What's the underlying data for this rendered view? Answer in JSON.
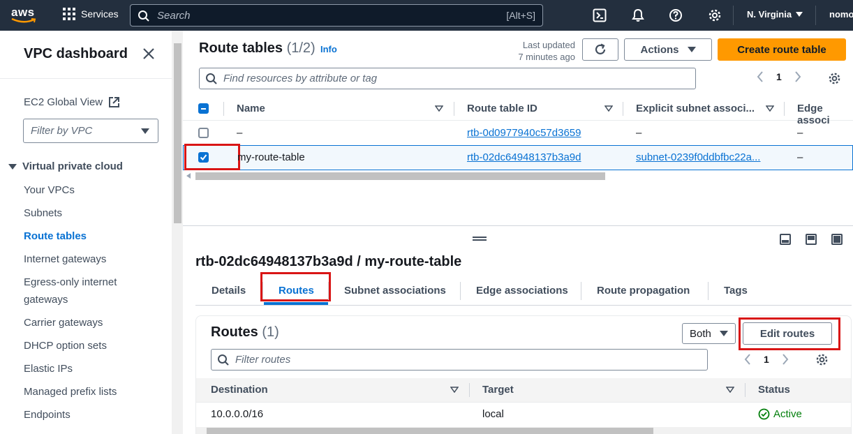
{
  "topnav": {
    "logo": "aws",
    "services": "Services",
    "search_placeholder": "Search",
    "search_shortcut": "[Alt+S]",
    "region": "N. Virginia",
    "account": "nomo"
  },
  "sidebar": {
    "title": "VPC dashboard",
    "ec2_global_view": "EC2 Global View",
    "filter_placeholder": "Filter by VPC",
    "section": "Virtual private cloud",
    "items": [
      {
        "label": "Your VPCs"
      },
      {
        "label": "Subnets"
      },
      {
        "label": "Route tables",
        "active": true
      },
      {
        "label": "Internet gateways"
      },
      {
        "label": "Egress-only internet"
      },
      {
        "label": "gateways"
      },
      {
        "label": "Carrier gateways"
      },
      {
        "label": "DHCP option sets"
      },
      {
        "label": "Elastic IPs"
      },
      {
        "label": "Managed prefix lists"
      },
      {
        "label": "Endpoints"
      }
    ]
  },
  "route_tables": {
    "title": "Route tables",
    "count": "(1/2)",
    "info": "Info",
    "last_updated_line1": "Last updated",
    "last_updated_line2": "7 minutes ago",
    "actions_label": "Actions",
    "create_label": "Create route table",
    "filter_placeholder": "Find resources by attribute or tag",
    "page": "1",
    "columns": [
      "Name",
      "Route table ID",
      "Explicit subnet associ...",
      "Edge associ"
    ],
    "rows": [
      {
        "name": "–",
        "id": "rtb-0d0977940c57d3659",
        "subnet": "–",
        "edge": "–",
        "selected": false
      },
      {
        "name": "my-route-table",
        "id": "rtb-02dc64948137b3a9d",
        "subnet": "subnet-0239f0ddbfbc22a...",
        "edge": "–",
        "selected": true
      }
    ]
  },
  "detail": {
    "title": "rtb-02dc64948137b3a9d / my-route-table",
    "tabs": [
      "Details",
      "Routes",
      "Subnet associations",
      "Edge associations",
      "Route propagation",
      "Tags"
    ],
    "active_tab": "Routes",
    "routes_title": "Routes",
    "routes_count": "(1)",
    "both_label": "Both",
    "edit_routes_label": "Edit routes",
    "filter_placeholder": "Filter routes",
    "page": "1",
    "columns": [
      "Destination",
      "Target",
      "Status"
    ],
    "rows": [
      {
        "destination": "10.0.0.0/16",
        "target": "local",
        "status": "Active"
      }
    ]
  },
  "colors": {
    "nav_bg": "#232f3e",
    "link": "#0972d3",
    "primary_button": "#ff9900",
    "annotation": "#d91515",
    "success": "#037f0c"
  }
}
